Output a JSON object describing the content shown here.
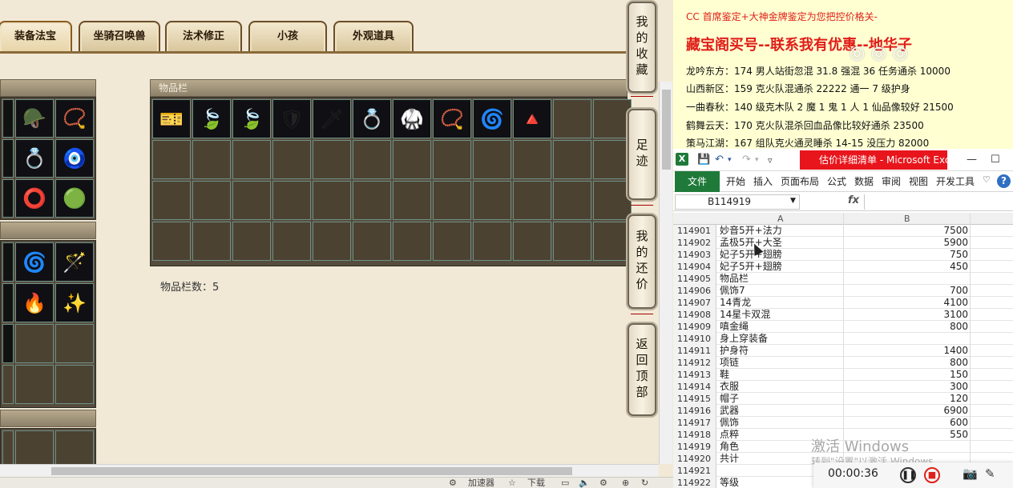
{
  "game": {
    "tabs": [
      {
        "label": "装备法宝",
        "active": true
      },
      {
        "label": "坐骑召唤兽",
        "active": false
      },
      {
        "label": "法术修正",
        "active": false
      },
      {
        "label": "小孩",
        "active": false
      },
      {
        "label": "外观道具",
        "active": false
      }
    ],
    "inventory_title": "物品栏",
    "inventory_count_label": "物品栏数：5",
    "side_buttons": [
      "我的收藏",
      "足迹",
      "我的还价",
      "返回顶部"
    ],
    "status_bar": {
      "speed": "加速器",
      "download": "下载"
    }
  },
  "notes": {
    "line0": "CC 首席鉴定+大神金牌鉴定为您把控价格关-",
    "line_big": "藏宝阁买号--联系我有优惠--地华子",
    "entries": [
      "龙吟东方：174 男人站街忽混 31.8 强混 36 任务通杀 10000",
      "山西新区：159 克火队混通杀 22222 通一 7 级护身",
      "一曲春秋：140 级克木队 2 魔 1 鬼 1 人 1 仙品像较好 21500",
      "鹤舞云天：170 克火队混杀回血品像比较好通杀 23500",
      "策马江湖：167 组队克火通灵睡杀 14-15 没压力 82000"
    ]
  },
  "excel": {
    "title": "估价详细清单 - Microsoft Excel(...",
    "ribbon_tabs": [
      "文件",
      "开始",
      "插入",
      "页面布局",
      "公式",
      "数据",
      "审阅",
      "视图",
      "开发工具"
    ],
    "name_box": "B114919",
    "fx": "fx",
    "col_headers": [
      "A",
      "B"
    ],
    "rows": [
      {
        "n": "114901",
        "a": "妙音5开+法力",
        "b": "7500"
      },
      {
        "n": "114902",
        "a": "孟极5开+大圣",
        "b": "5900"
      },
      {
        "n": "114903",
        "a": "妃子5开+翅膀",
        "b": "750"
      },
      {
        "n": "114904",
        "a": "妃子5开+翅膀",
        "b": "450"
      },
      {
        "n": "114905",
        "a": "物品栏",
        "b": ""
      },
      {
        "n": "114906",
        "a": "佩饰7",
        "b": "700"
      },
      {
        "n": "114907",
        "a": "14青龙",
        "b": "4100"
      },
      {
        "n": "114908",
        "a": "14星卡双混",
        "b": "3100"
      },
      {
        "n": "114909",
        "a": "嗔金绳",
        "b": "800"
      },
      {
        "n": "114910",
        "a": "身上穿装备",
        "b": ""
      },
      {
        "n": "114911",
        "a": "护身符",
        "b": "1400"
      },
      {
        "n": "114912",
        "a": "项链",
        "b": "800"
      },
      {
        "n": "114913",
        "a": "鞋",
        "b": "150"
      },
      {
        "n": "114914",
        "a": "衣服",
        "b": "300"
      },
      {
        "n": "114915",
        "a": "帽子",
        "b": "120"
      },
      {
        "n": "114916",
        "a": "武器",
        "b": "6900"
      },
      {
        "n": "114917",
        "a": "佩饰",
        "b": "600"
      },
      {
        "n": "114918",
        "a": "点粹",
        "b": "550"
      },
      {
        "n": "114919",
        "a": "角色",
        "b": ""
      },
      {
        "n": "114920",
        "a": "共计",
        "b": ""
      },
      {
        "n": "114921",
        "a": "",
        "b": ""
      },
      {
        "n": "114922",
        "a": "等级",
        "b": ""
      }
    ],
    "activate_title": "激活 Windows",
    "activate_sub": "转到\"设置\"以激活 Windows。"
  },
  "recorder": {
    "time": "00:00:36"
  }
}
